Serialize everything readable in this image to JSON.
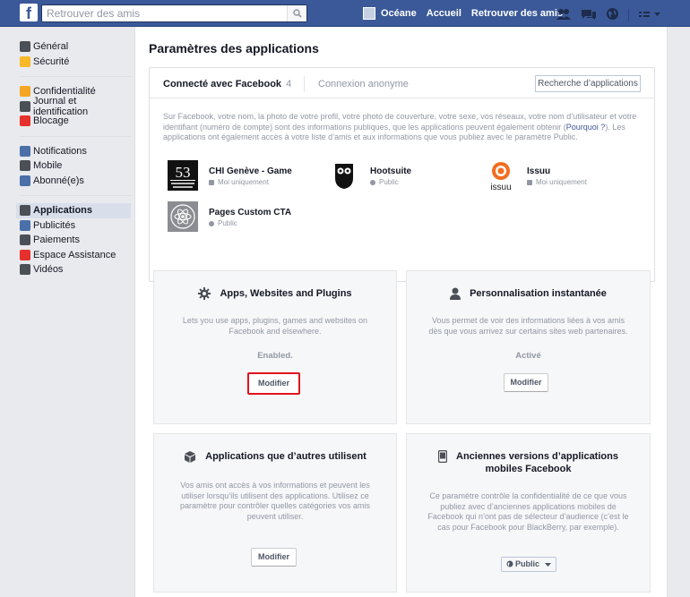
{
  "topbar": {
    "logo": "f",
    "search_placeholder": "Retrouver des amis",
    "user_name": "Océane",
    "home": "Accueil",
    "find_friends": "Retrouver des amis"
  },
  "sidebar": {
    "groups": [
      [
        {
          "label": "Général",
          "icon": "gears-icon",
          "color": "#4b4f56"
        },
        {
          "label": "Sécurité",
          "icon": "badge-icon",
          "color": "#f7b928"
        }
      ],
      [
        {
          "label": "Confidentialité",
          "icon": "lock-icon",
          "color": "#f5a623"
        },
        {
          "label": "Journal et identification",
          "icon": "timeline-icon",
          "color": "#4b4f56"
        },
        {
          "label": "Blocage",
          "icon": "block-icon",
          "color": "#e5302b"
        }
      ],
      [
        {
          "label": "Notifications",
          "icon": "globe-icon",
          "color": "#4b6fa8"
        },
        {
          "label": "Mobile",
          "icon": "mobile-icon",
          "color": "#4b4f56"
        },
        {
          "label": "Abonné(e)s",
          "icon": "rss-icon",
          "color": "#4b6fa8"
        }
      ],
      [
        {
          "label": "Applications",
          "icon": "apps-icon",
          "color": "#4b4f56",
          "active": true
        },
        {
          "label": "Publicités",
          "icon": "ads-icon",
          "color": "#4b6fa8"
        },
        {
          "label": "Paiements",
          "icon": "payments-icon",
          "color": "#4b4f56"
        },
        {
          "label": "Espace Assistance",
          "icon": "lifebuoy-icon",
          "color": "#e5302b"
        },
        {
          "label": "Vidéos",
          "icon": "video-icon",
          "color": "#4b4f56"
        }
      ]
    ]
  },
  "main": {
    "title": "Paramètres des applications",
    "tabs": {
      "connected": "Connecté avec Facebook",
      "connected_count": "4",
      "anonymous": "Connexion anonyme",
      "search_button": "Recherche d’applications"
    },
    "info_text": "Sur Facebook, votre nom, la photo de votre profil, votre photo de couverture, votre sexe, vos réseaux, votre nom d’utilisateur et votre identifiant (numéro de compte) sont des informations publiques, que les applications peuvent également obtenir (",
    "info_link": "Pourquoi ?",
    "info_text2": "). Les applications ont également accès à votre liste d’amis et aux informations que vous publiez avec le paramètre Public.",
    "apps": [
      {
        "name": "CHI Genève - Game",
        "privacy": "Moi uniquement",
        "thumb": "53 Concours Hippique"
      },
      {
        "name": "Hootsuite",
        "privacy": "Public"
      },
      {
        "name": "Issuu",
        "privacy": "Moi uniquement",
        "thumb": "issuu"
      },
      {
        "name": "Pages Custom CTA",
        "privacy": "Public"
      }
    ]
  },
  "cards": {
    "apps_plugins": {
      "title": "Apps, Websites and Plugins",
      "desc": "Lets you use apps, plugins, games and websites on Facebook and elsewhere.",
      "status": "Enabled.",
      "button": "Modifier"
    },
    "instant": {
      "title": "Personnalisation instantanée",
      "desc": "Vous permet de voir des informations liées à vos amis dès que vous arrivez sur certains sites web partenaires.",
      "status": "Activé",
      "button": "Modifier"
    },
    "others": {
      "title": "Applications que d’autres utilisent",
      "desc": "Vos amis ont accès à vos informations et peuvent les utiliser lorsqu’ils utilisent des applications. Utilisez ce paramètre pour contrôler quelles catégories vos amis peuvent utiliser.",
      "button": "Modifier"
    },
    "old_mobile": {
      "title_line1": "Anciennes versions d’applications",
      "title_line2": "mobiles Facebook",
      "desc": "Ce paramètre contrôle la confidentialité de ce que vous publiez avec d’anciennes applications mobiles de Facebook qui n’ont pas de sélecteur d’audience (c’est le cas pour Facebook pour BlackBerry, par exemple).",
      "dropdown": "Public"
    }
  },
  "colors": {
    "topbar": "#3b5998",
    "highlight": "#e0141d",
    "link": "#3b5998"
  }
}
